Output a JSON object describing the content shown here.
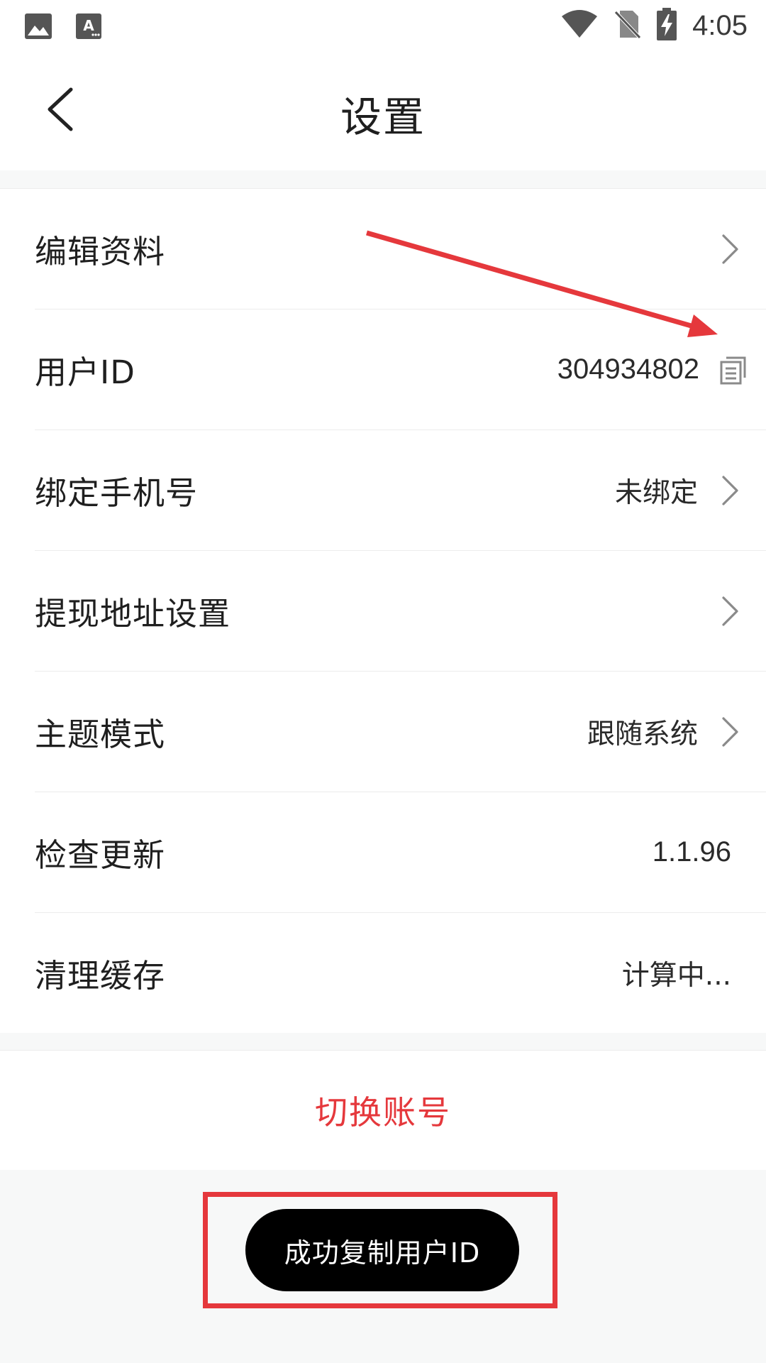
{
  "status_bar": {
    "time": "4:05",
    "icons": [
      "image-notification-icon",
      "text-notification-icon",
      "wifi-icon",
      "no-sim-icon",
      "battery-charging-icon"
    ]
  },
  "header": {
    "title": "设置",
    "back_icon": "chevron-left-icon"
  },
  "settings": {
    "items": [
      {
        "label": "编辑资料",
        "value": "",
        "trailing": "chevron-right-icon"
      },
      {
        "label": "用户ID",
        "value": "304934802",
        "trailing": "copy-icon"
      },
      {
        "label": "绑定手机号",
        "value": "未绑定",
        "trailing": "chevron-right-icon"
      },
      {
        "label": "提现地址设置",
        "value": "",
        "trailing": "chevron-right-icon"
      },
      {
        "label": "主题模式",
        "value": "跟随系统",
        "trailing": "chevron-right-icon"
      },
      {
        "label": "检查更新",
        "value": "1.1.96",
        "trailing": ""
      },
      {
        "label": "清理缓存",
        "value": "计算中...",
        "trailing": ""
      }
    ]
  },
  "switch_account": {
    "label": "切换账号"
  },
  "toast": {
    "message": "成功复制用户ID"
  },
  "colors": {
    "accent_red": "#e5383c",
    "toast_bg": "#000000",
    "page_bg": "#f7f8f8"
  }
}
